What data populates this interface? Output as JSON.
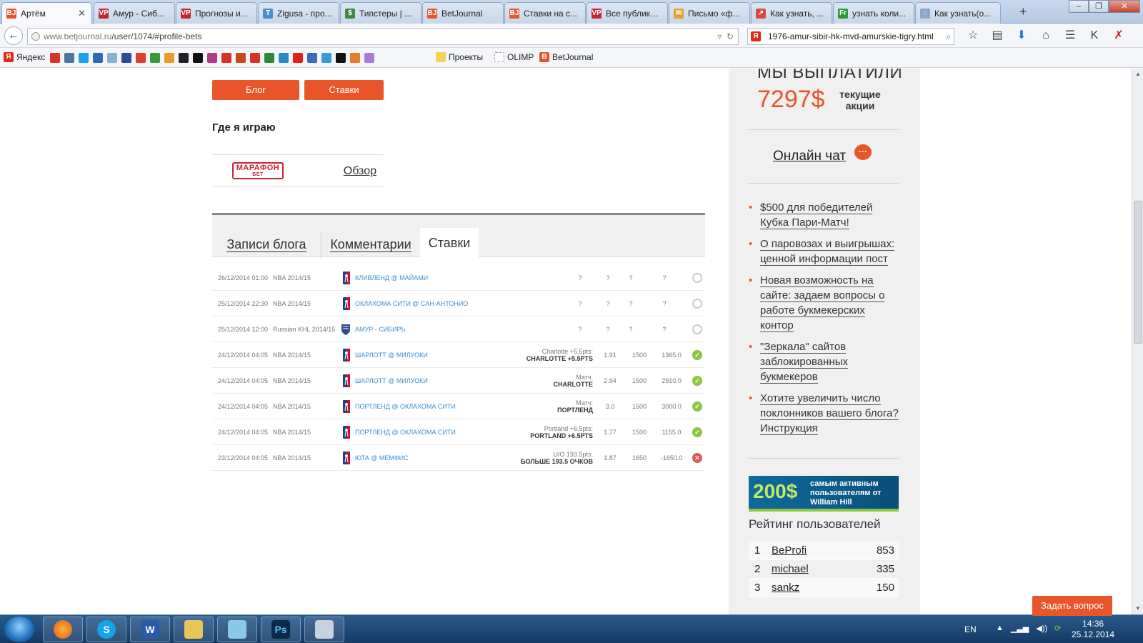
{
  "browser": {
    "tabs": [
      {
        "label": "Артём",
        "favicon_text": "BJ",
        "favicon_color": "#e8552a",
        "active": true
      },
      {
        "label": "Амур - Сиб...",
        "favicon_text": "VP",
        "favicon_color": "#c7262d"
      },
      {
        "label": "Прогнозы и...",
        "favicon_text": "VP",
        "favicon_color": "#c7262d"
      },
      {
        "label": "Zigusa - про...",
        "favicon_text": "T",
        "favicon_color": "#4a90c8"
      },
      {
        "label": "Типстеры | ...",
        "favicon_text": "$",
        "favicon_color": "#3a8b3a"
      },
      {
        "label": "BetJournal",
        "favicon_text": "BJ",
        "favicon_color": "#e8552a"
      },
      {
        "label": "Ставки на с...",
        "favicon_text": "BJ",
        "favicon_color": "#e8552a"
      },
      {
        "label": "Все публика...",
        "favicon_text": "VP",
        "favicon_color": "#c7262d"
      },
      {
        "label": "Письмо «ф...",
        "favicon_text": "✉",
        "favicon_color": "#e8a02a"
      },
      {
        "label": "Как узнать, ...",
        "favicon_text": "↗",
        "favicon_color": "#d84a3a"
      },
      {
        "label": "узнать коли...",
        "favicon_text": "Fr",
        "favicon_color": "#2a9a3a"
      },
      {
        "label": "Как узнать(о...",
        "favicon_text": "◌",
        "favicon_color": "#8aa6c8"
      }
    ],
    "new_tab": "+",
    "url_host": "www.betjournal.ru",
    "url_path": "/user/1074/#profile-bets",
    "search_text": "1976-amur-sibir-hk-mvd-amurskie-tigry.html",
    "bookmarks": {
      "yandex": "Яндекс",
      "projects": "Проекты",
      "olimp": "OLIMP",
      "betjournal": "BetJournal"
    }
  },
  "profile": {
    "blog_button": "Блог",
    "bets_button": "Ставки",
    "where_title": "Где я играю",
    "bookmaker_logo_top": "МАРАФОН",
    "bookmaker_logo_bottom": "БЕТ",
    "review_link": "Обзор",
    "tabs": [
      {
        "label": "Записи блога"
      },
      {
        "label": "Комментарии"
      },
      {
        "label": "Ставки"
      }
    ]
  },
  "bets": [
    {
      "date": "26/12/2014 01:00",
      "league": "NBA 2014/15",
      "sport": "nba",
      "match": "КЛИВЛЕНД @ МАЙАМИ",
      "bet_top": "",
      "bet_bottom": "",
      "odds": "?",
      "stake": "?",
      "result": "?",
      "extra": "?",
      "status": "pending"
    },
    {
      "date": "25/12/2014 22:30",
      "league": "NBA 2014/15",
      "sport": "nba",
      "match": "ОКЛАХОМА СИТИ @ САН-АНТОНИО",
      "bet_top": "",
      "bet_bottom": "",
      "odds": "?",
      "stake": "?",
      "result": "?",
      "extra": "?",
      "status": "pending"
    },
    {
      "date": "25/12/2014 12:00",
      "league": "Russian KHL 2014/15",
      "sport": "khl",
      "match": "АМУР - СИБИРЬ",
      "bet_top": "",
      "bet_bottom": "",
      "odds": "?",
      "stake": "?",
      "result": "?",
      "extra": "?",
      "status": "pending"
    },
    {
      "date": "24/12/2014 04:05",
      "league": "NBA 2014/15",
      "sport": "nba",
      "match": "ШАРЛОТТ @ МИЛУОКИ",
      "bet_top": "Charlotte +5.5pts:",
      "bet_bottom": "CHARLOTTE +5.5PTS",
      "odds": "1.91",
      "stake": "1500",
      "result": "1365.0",
      "extra": "",
      "status": "win"
    },
    {
      "date": "24/12/2014 04:05",
      "league": "NBA 2014/15",
      "sport": "nba",
      "match": "ШАРЛОТТ @ МИЛУОКИ",
      "bet_top": "Матч:",
      "bet_bottom": "CHARLOTTE",
      "odds": "2.94",
      "stake": "1500",
      "result": "2910.0",
      "extra": "",
      "status": "win"
    },
    {
      "date": "24/12/2014 04:05",
      "league": "NBA 2014/15",
      "sport": "nba",
      "match": "ПОРТЛЕНД @ ОКЛАХОМА СИТИ",
      "bet_top": "Матч:",
      "bet_bottom": "ПОРТЛЕНД",
      "odds": "3.0",
      "stake": "1500",
      "result": "3000.0",
      "extra": "",
      "status": "win"
    },
    {
      "date": "24/12/2014 04:05",
      "league": "NBA 2014/15",
      "sport": "nba",
      "match": "ПОРТЛЕНД @ ОКЛАХОМА СИТИ",
      "bet_top": "Portland +6.5pts:",
      "bet_bottom": "PORTLAND +6.5PTS",
      "odds": "1.77",
      "stake": "1500",
      "result": "1155.0",
      "extra": "",
      "status": "win"
    },
    {
      "date": "23/12/2014 04:05",
      "league": "NBA 2014/15",
      "sport": "nba",
      "match": "ЮТА @ МЕМФИС",
      "bet_top": "U/O 193.5pts:",
      "bet_bottom": "БОЛЬШЕ 193.5 ОЧКОВ",
      "odds": "1.87",
      "stake": "1650",
      "result": "-1650.0",
      "extra": "",
      "status": "loss"
    }
  ],
  "sidebar": {
    "paid_title": "МЫ ВЫПЛАТИЛИ",
    "paid_amount": "7297$",
    "promo_label": "текущие акции",
    "chat_link": "Онлайн чат",
    "news": [
      "$500 для победителей Кубка Пари-Матч!",
      "О паровозах и выигрышах: ценной информации пост",
      "Новая возможность на сайте: задаем вопросы о работе букмекерских контор",
      "\"Зеркала\" сайтов заблокированных букмекеров",
      "Хотите увеличить число поклонников вашего блога? Инструкция"
    ],
    "banner_big": "200$",
    "banner_text": "самым активным пользователям от William Hill",
    "rating_title": "Рейтинг пользователей",
    "rating": [
      {
        "pos": "1",
        "name": "BeProfi",
        "points": "853"
      },
      {
        "pos": "2",
        "name": "michael",
        "points": "335"
      },
      {
        "pos": "3",
        "name": "sankz",
        "points": "150"
      }
    ]
  },
  "ask_button": "Задать вопрос",
  "taskbar": {
    "lang": "EN",
    "time": "14:36",
    "date": "25.12.2014"
  },
  "colors": {
    "accent": "#e8552a",
    "link": "#3a8fcf",
    "win": "#8dc63f",
    "loss": "#e25858"
  }
}
